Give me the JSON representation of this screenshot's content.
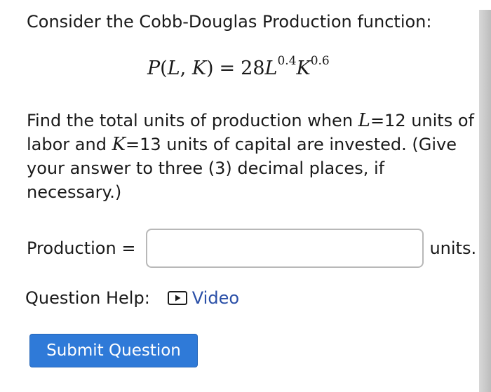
{
  "problem": {
    "intro": "Consider the Cobb-Douglas Production function:",
    "formula": {
      "function_name": "P",
      "arg_1": "L",
      "arg_2": "K",
      "coefficient": "28",
      "var_1": "L",
      "exp_1": "0.4",
      "var_2": "K",
      "exp_2": "0.6"
    },
    "question": {
      "part_1": "Find the total units of production when ",
      "var_l": "L",
      "part_2": "=12 units of",
      "part_3": "labor and ",
      "var_k": "K",
      "part_4": "=13 units of capital are invested. (Give",
      "line_3": "your answer to three (3) decimal places, if",
      "line_4": "necessary.)"
    }
  },
  "answer": {
    "label": "Production =",
    "value": "",
    "units": "units."
  },
  "help": {
    "label": "Question Help:",
    "video_label": "Video",
    "video_icon": "play-icon"
  },
  "submit": {
    "label": "Submit Question",
    "color": "#2f7ad8"
  },
  "colors": {
    "link": "#2a4fa7",
    "button": "#2f7ad8"
  }
}
